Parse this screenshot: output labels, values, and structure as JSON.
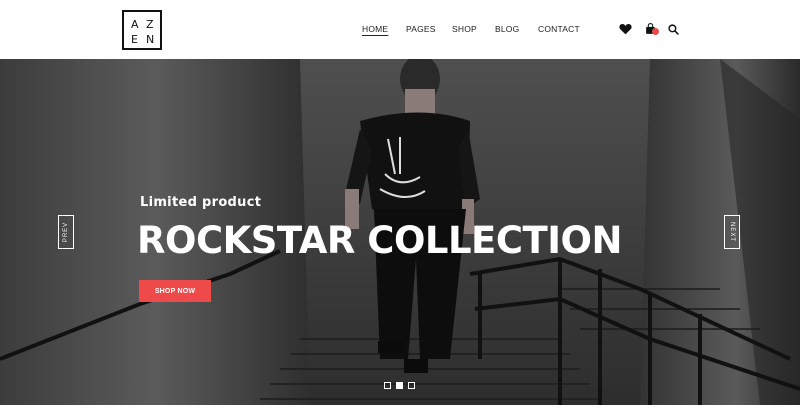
{
  "header": {
    "logo_letters": [
      "A",
      "Z",
      "E",
      "N"
    ],
    "nav": [
      {
        "label": "HOME",
        "active": true
      },
      {
        "label": "PAGES",
        "active": false
      },
      {
        "label": "SHOP",
        "active": false
      },
      {
        "label": "BLOG",
        "active": false
      },
      {
        "label": "CONTACT",
        "active": false
      }
    ],
    "icons": [
      "heart-icon",
      "cart-icon",
      "search-icon"
    ],
    "cart_badge_color": "#e84a4a"
  },
  "hero": {
    "subtitle": "Limited product",
    "title": "ROCKSTAR COLLECTION",
    "cta_label": "SHOP NOW",
    "cta_color": "#ef4a4a",
    "prev_label": "PREV",
    "next_label": "NEXT",
    "slide_count": 3,
    "active_slide": 2
  }
}
